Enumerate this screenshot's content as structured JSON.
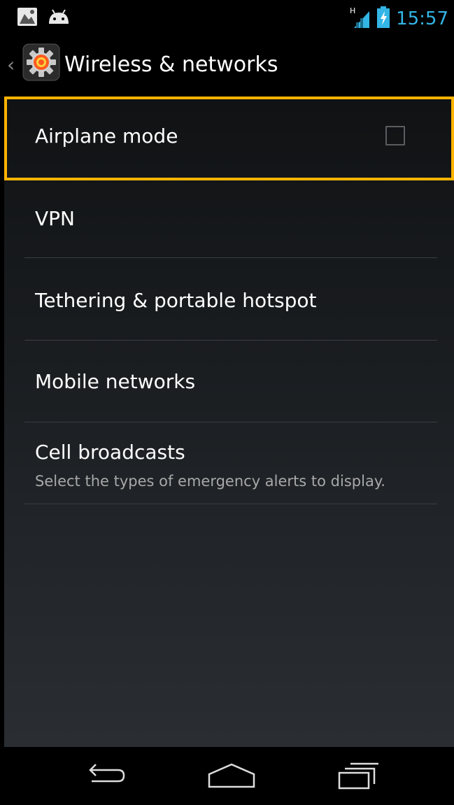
{
  "status_bar": {
    "time": "15:57",
    "network_type": "H",
    "left_icons": [
      "notification-image-icon",
      "android-icon"
    ],
    "right_icons": [
      "signal-icon",
      "battery-charging-icon"
    ]
  },
  "action_bar": {
    "title": "Wireless & networks",
    "icon": "settings-gear-icon"
  },
  "settings": [
    {
      "id": "airplane",
      "title": "Airplane mode",
      "checked": false
    },
    {
      "id": "vpn",
      "title": "VPN"
    },
    {
      "id": "tethering",
      "title": "Tethering & portable hotspot"
    },
    {
      "id": "mobile",
      "title": "Mobile networks"
    },
    {
      "id": "cell",
      "title": "Cell broadcasts",
      "summary": "Select the types of emergency alerts to display."
    }
  ],
  "nav": [
    "back-icon",
    "home-icon",
    "recent-apps-icon"
  ],
  "colors": {
    "accent": "#33b5e5",
    "highlight": "#ffb300",
    "summary": "#a8a8a8"
  }
}
